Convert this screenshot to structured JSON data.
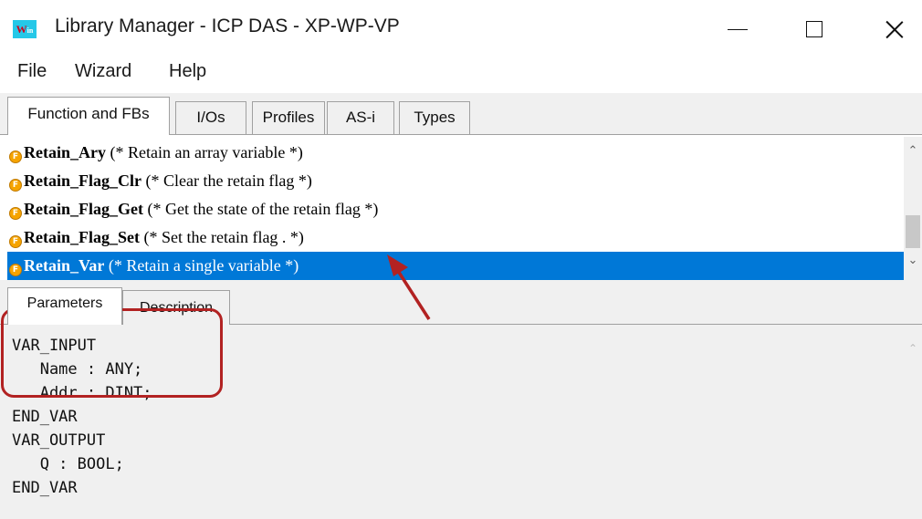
{
  "window": {
    "title": "Library Manager - ICP DAS - XP-WP-VP",
    "icon_label": "Win",
    "icon_label_main": "W",
    "icon_label_sub": "in"
  },
  "menu": [
    "File",
    "Wizard",
    "Help"
  ],
  "top_tabs": [
    "Function and FBs",
    "I/Os",
    "Profiles",
    "AS-i",
    "Types"
  ],
  "active_top_tab": "Function and FBs",
  "functions": [
    {
      "name": "Retain_Ary",
      "desc": " (* Retain an array variable *)"
    },
    {
      "name": "Retain_Flag_Clr",
      "desc": " (* Clear the retain flag *)"
    },
    {
      "name": "Retain_Flag_Get",
      "desc": " (* Get the state of the retain flag *)"
    },
    {
      "name": "Retain_Flag_Set",
      "desc": " (* Set the retain flag . *)"
    },
    {
      "name": "Retain_Var",
      "desc": " (* Retain a single variable *)"
    }
  ],
  "selected_function": "Retain_Var",
  "function_icon_letter": "F",
  "lower_tabs": [
    "Parameters",
    "Description"
  ],
  "active_lower_tab": "Parameters",
  "code_lines": [
    "VAR_INPUT",
    "   Name : ANY;",
    "   Addr : DINT;",
    "END_VAR",
    "VAR_OUTPUT",
    "   Q : BOOL;",
    "END_VAR"
  ],
  "colors": {
    "selection": "#0078d7",
    "annotation": "#b22222",
    "function_icon": "#f6a400",
    "app_icon_bg": "#25c8e8"
  },
  "icons": {
    "app": "app-icon",
    "minimize": "minimize-icon",
    "maximize": "maximize-icon",
    "close": "close-icon",
    "function": "function-icon",
    "scroll_up": "chevron-up-icon",
    "scroll_down": "chevron-down-icon"
  }
}
